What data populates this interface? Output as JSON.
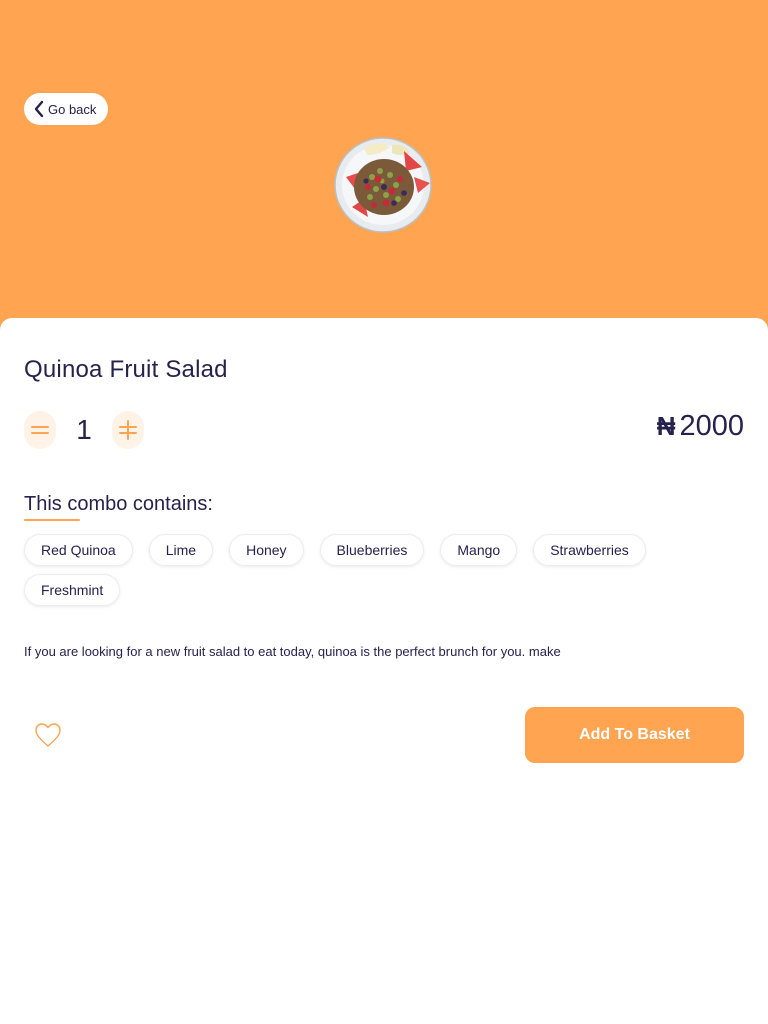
{
  "header": {
    "back_label": "Go back",
    "hero_color": "#FFA451"
  },
  "product": {
    "name": "Quinoa Fruit Salad",
    "quantity": "1",
    "currency_symbol": "₦",
    "price": "2000",
    "image_icon": "salad-plate-image"
  },
  "combo": {
    "label": "This combo contains:",
    "items": [
      "Red Quinoa",
      "Lime",
      "Honey",
      "Blueberries",
      "Mango",
      "Strawberries",
      "Freshmint"
    ]
  },
  "description": "If you are looking for a new fruit salad to eat today, quinoa is the perfect brunch for you. make",
  "actions": {
    "favorite_icon": "heart-icon",
    "add_label": "Add To Basket"
  },
  "colors": {
    "accent": "#FFA451",
    "accent_light": "#FFF2E7",
    "text": "#27214D"
  }
}
